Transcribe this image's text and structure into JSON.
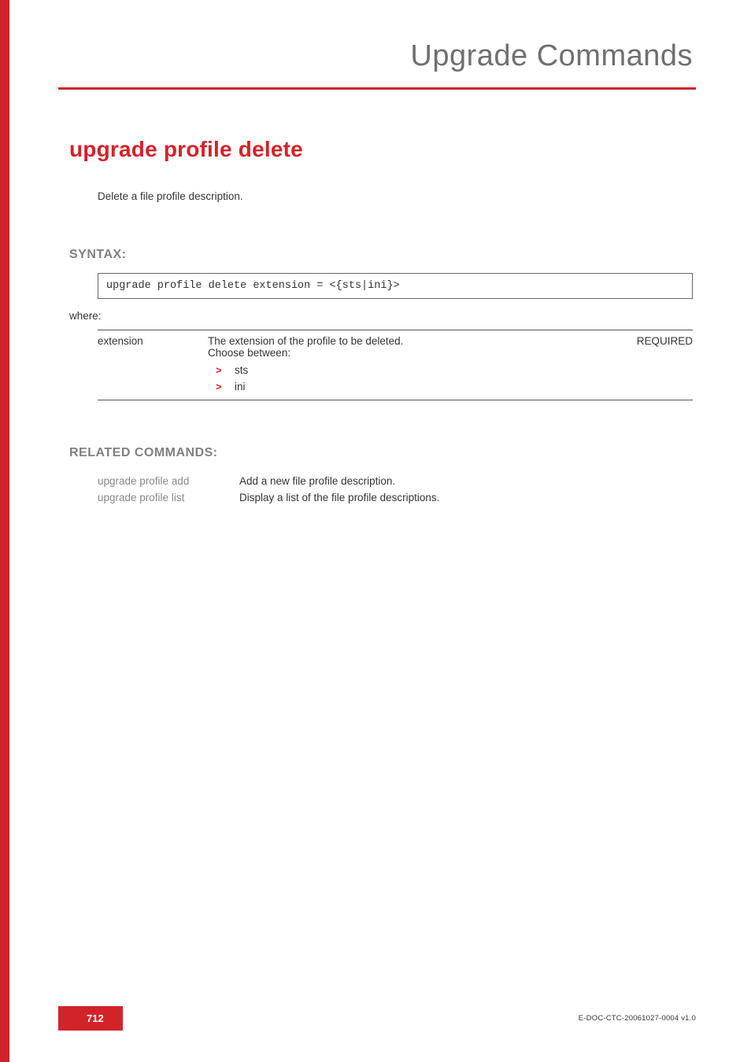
{
  "header": {
    "title": "Upgrade Commands"
  },
  "command": {
    "title": "upgrade profile delete",
    "description": "Delete a file profile description."
  },
  "syntax": {
    "heading": "SYNTAX:",
    "code": "upgrade profile delete  extension = <{sts|ini}>",
    "where_label": "where:",
    "params": [
      {
        "name": "extension",
        "desc_line1": "The extension of the profile to be deleted.",
        "desc_line2": "Choose between:",
        "options": [
          "sts",
          "ini"
        ],
        "required": "REQUIRED"
      }
    ]
  },
  "related": {
    "heading": "RELATED COMMANDS:",
    "rows": [
      {
        "name": "upgrade profile add",
        "desc": "Add a new file profile description."
      },
      {
        "name": "upgrade profile list",
        "desc": "Display a list of the file profile descriptions."
      }
    ]
  },
  "footer": {
    "page_number": "712",
    "doc_id": "E-DOC-CTC-20061027-0004 v1.0"
  }
}
